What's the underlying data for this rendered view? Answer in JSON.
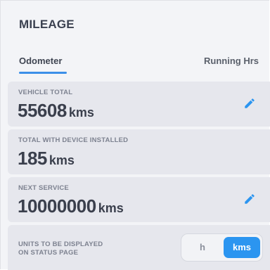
{
  "header": {
    "title": "MILEAGE"
  },
  "tabs": [
    {
      "label": "Odometer",
      "active": true
    },
    {
      "label": "Running Hrs",
      "active": false
    }
  ],
  "vehicle_total": {
    "label": "VEHICLE TOTAL",
    "value": "55608",
    "unit": "kms",
    "icon": "pencil-icon"
  },
  "device_total": {
    "label": "TOTAL WITH DEVICE INSTALLED",
    "value": "185",
    "unit": "kms"
  },
  "next_service": {
    "label": "NEXT SERVICE",
    "value": "10000000",
    "unit": "kms",
    "icon": "pencil-icon"
  },
  "units": {
    "label_line1": "UNITS TO BE DISPLAYED",
    "label_line2": "ON STATUS PAGE",
    "options": [
      "h",
      "kms"
    ],
    "selected": "kms"
  },
  "colors": {
    "accent": "#2b95f0",
    "text_dark": "#3a3f4c",
    "label_grey": "#7d8290",
    "card_bg": "#e6e7ed",
    "panel_bg": "#f3f4f7"
  }
}
